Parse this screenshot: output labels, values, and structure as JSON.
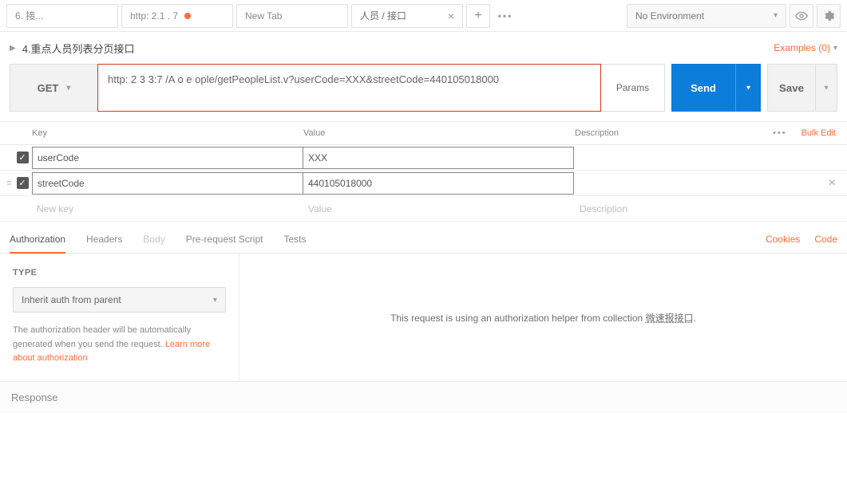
{
  "topbar": {
    "tabs": [
      {
        "label": "6.           接..."
      },
      {
        "label": "http:     2.1     .    7",
        "unsaved": true
      },
      {
        "label": "New Tab"
      },
      {
        "label": "        人员   /   接口",
        "active": true,
        "closable": true
      }
    ],
    "add_label": "+",
    "more_label": "•••",
    "environment": "No Environment"
  },
  "request": {
    "title_prefix": "▶",
    "title": "4.重点人员列表分页接口",
    "examples_label": "Examples (0)",
    "method": "GET",
    "url": "http:     2     3     3:7     /A          o          e              ople/getPeopleList.v?userCode=XXX&streetCode=440105018000",
    "params_label": "Params",
    "send_label": "Send",
    "save_label": "Save"
  },
  "params_table": {
    "headers": {
      "key": "Key",
      "value": "Value",
      "description": "Description"
    },
    "bulk_edit": "Bulk Edit",
    "rows": [
      {
        "checked": true,
        "key": "userCode",
        "value": "XXX"
      },
      {
        "checked": true,
        "key": "streetCode",
        "value": "440105018000",
        "closable": true,
        "drag": true
      }
    ],
    "new_row": {
      "key": "New key",
      "value": "Value",
      "description": "Description"
    }
  },
  "subtabs": {
    "items": [
      "Authorization",
      "Headers",
      "Body",
      "Pre-request Script",
      "Tests"
    ],
    "active": 0,
    "disabled": [
      2
    ],
    "cookies": "Cookies",
    "code": "Code"
  },
  "auth": {
    "type_label": "TYPE",
    "type_value": "Inherit auth from parent",
    "note_prefix": "The authorization header will be automatically generated when you send the request. ",
    "note_link": "Learn more about authorization",
    "helper_prefix": "This request is using an authorization helper from collection ",
    "helper_collection": "微速报接口",
    "helper_suffix": "."
  },
  "response_label": "Response"
}
